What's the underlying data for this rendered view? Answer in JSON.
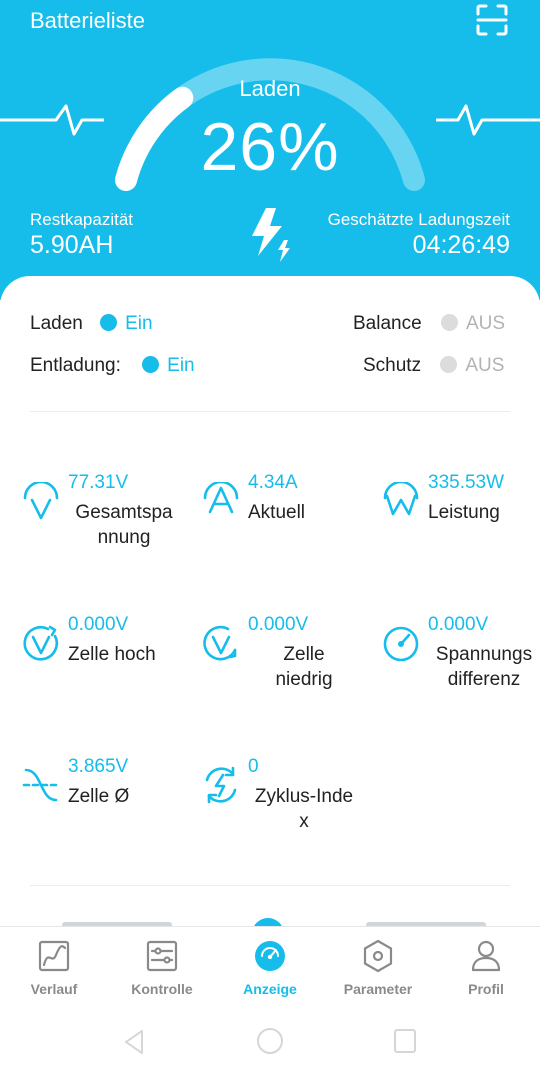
{
  "header": {
    "title": "Batterieliste",
    "charge_label": "Laden",
    "charge_percent": "26%",
    "charge_fraction": 0.26,
    "rest_capacity_title": "Restkapazität",
    "rest_capacity_value": "5.90AH",
    "charge_time_title": "Geschätzte Ladungszeit",
    "charge_time_value": "04:26:49"
  },
  "status": {
    "laden": {
      "label": "Laden",
      "value": "Ein"
    },
    "entladung": {
      "label": "Entladung:",
      "value": "Ein"
    },
    "balance": {
      "label": "Balance",
      "value": "AUS"
    },
    "schutz": {
      "label": "Schutz",
      "value": "AUS"
    }
  },
  "metrics": [
    {
      "value": "77.31V",
      "label": "Gesamtspa\nnnung",
      "icon": "total-voltage-icon"
    },
    {
      "value": "4.34A",
      "label": "Aktuell",
      "icon": "current-icon"
    },
    {
      "value": "335.53W",
      "label": "Leistung",
      "icon": "power-icon"
    },
    {
      "value": "0.000V",
      "label": "Zelle hoch",
      "icon": "cell-high-icon"
    },
    {
      "value": "0.000V",
      "label": "Zelle\nniedrig",
      "icon": "cell-low-icon"
    },
    {
      "value": "0.000V",
      "label": "Spannungs\ndifferenz",
      "icon": "voltage-difference-icon"
    },
    {
      "value": "3.865V",
      "label": "Zelle Ø",
      "icon": "cell-average-icon"
    },
    {
      "value": "0",
      "label": "Zyklus-Inde\nx",
      "icon": "cycle-index-icon"
    }
  ],
  "tabs": [
    {
      "label": "Verlauf",
      "icon": "history-chart-icon",
      "active": false
    },
    {
      "label": "Kontrolle",
      "icon": "control-sliders-icon",
      "active": false
    },
    {
      "label": "Anzeige",
      "icon": "gauge-icon",
      "active": true
    },
    {
      "label": "Parameter",
      "icon": "hexagon-settings-icon",
      "active": false
    },
    {
      "label": "Profil",
      "icon": "profile-icon",
      "active": false
    }
  ],
  "colors": {
    "accent": "#16bdea",
    "inactive_dot": "#dcdcdc",
    "inactive_text": "#b3b3b3",
    "tab_inactive": "#8a8a8a"
  }
}
